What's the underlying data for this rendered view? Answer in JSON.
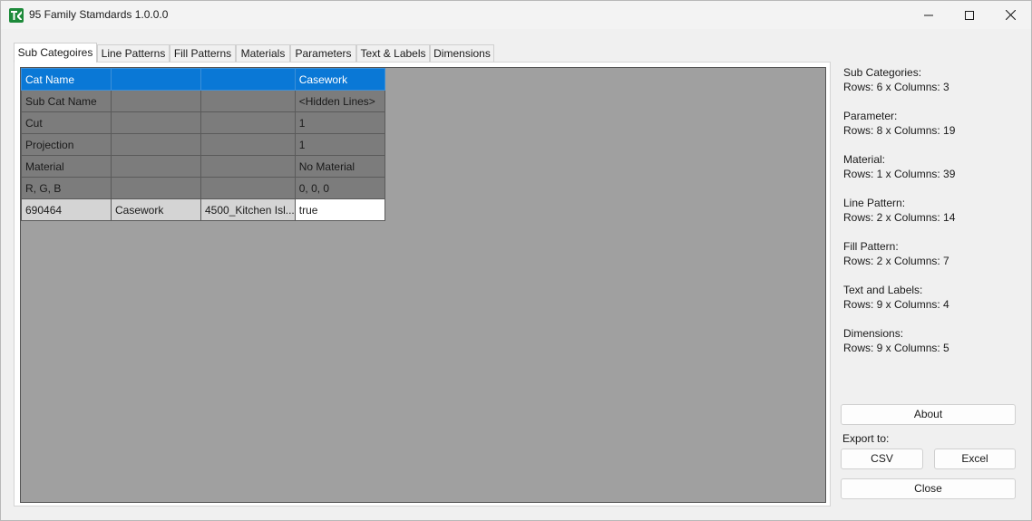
{
  "window": {
    "title": "95 Family Stamdards 1.0.0.0",
    "controls": {
      "minimize": "minimize",
      "maximize": "maximize",
      "close": "close"
    },
    "app_icon_color": "#1d8a3a"
  },
  "tabs": [
    {
      "label": "Sub Categoires",
      "active": true
    },
    {
      "label": "Line Patterns"
    },
    {
      "label": "Fill Patterns"
    },
    {
      "label": "Materials"
    },
    {
      "label": "Parameters"
    },
    {
      "label": "Text & Labels"
    },
    {
      "label": "Dimensions"
    }
  ],
  "grid": {
    "rows": [
      [
        "Cat Name",
        "",
        "",
        "Casework"
      ],
      [
        "Sub Cat Name",
        "",
        "",
        "<Hidden Lines>"
      ],
      [
        "Cut",
        "",
        "",
        "1"
      ],
      [
        "Projection",
        "",
        "",
        "1"
      ],
      [
        "Material",
        "",
        "",
        "No Material"
      ],
      [
        "R, G, B",
        "",
        "",
        "0, 0, 0"
      ],
      [
        "690464",
        "Casework",
        "4500_Kitchen Isl...",
        "true"
      ]
    ]
  },
  "stats": [
    {
      "label": "Sub Categories:",
      "value": "Rows: 6 x Columns: 3"
    },
    {
      "label": "Parameter:",
      "value": "Rows: 8 x Columns: 19"
    },
    {
      "label": "Material:",
      "value": "Rows: 1 x Columns: 39"
    },
    {
      "label": "Line Pattern:",
      "value": "Rows: 2 x Columns: 14"
    },
    {
      "label": "Fill Pattern:",
      "value": "Rows: 2 x Columns: 7"
    },
    {
      "label": "Text and Labels:",
      "value": "Rows: 9 x Columns: 4"
    },
    {
      "label": "Dimensions:",
      "value": "Rows: 9 x Columns: 5"
    }
  ],
  "buttons": {
    "about": "About",
    "export_label": "Export to:",
    "csv": "CSV",
    "excel": "Excel",
    "close": "Close"
  },
  "colors": {
    "selection": "#0a78d6",
    "grid_background": "#a0a0a0"
  }
}
